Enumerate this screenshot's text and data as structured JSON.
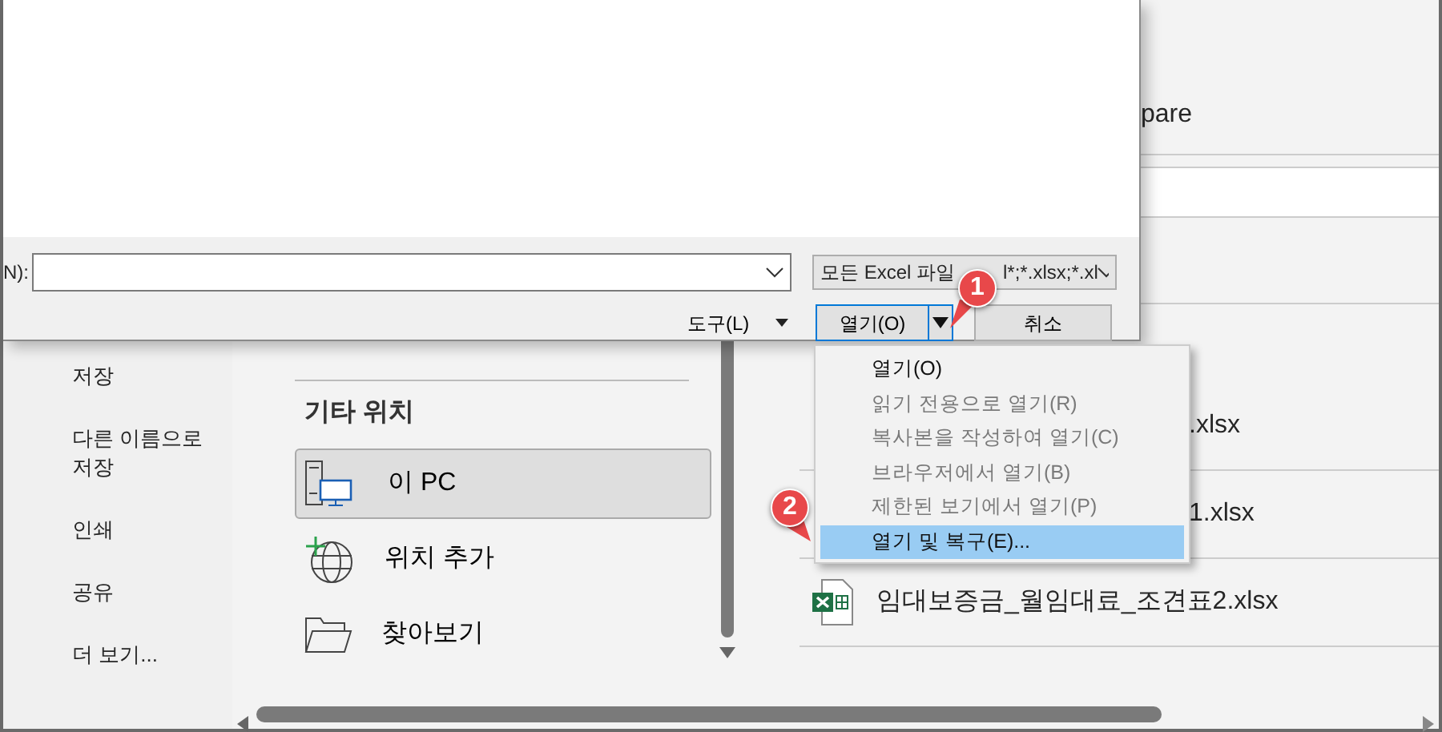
{
  "backstage": {
    "nav": [
      {
        "label": "저장"
      },
      {
        "label": "다른 이름으로\n저장"
      },
      {
        "label": "인쇄"
      },
      {
        "label": "공유"
      },
      {
        "label": "더 보기..."
      }
    ],
    "locations_heading": "기타 위치",
    "locations": [
      {
        "label": "이 PC",
        "kind": "pc",
        "selected": true
      },
      {
        "label": "위치 추가",
        "kind": "globe",
        "selected": false
      },
      {
        "label": "찾아보기",
        "kind": "folder",
        "selected": false
      }
    ],
    "files": [
      {
        "name": "pare",
        "kind": "top"
      },
      {
        "name": ".xlsx",
        "kind": "under-menu"
      },
      {
        "name": "1.xlsx",
        "kind": "under-menu"
      },
      {
        "name": "임대보증금_월임대료_조견표2.xlsx",
        "kind": "excel"
      }
    ]
  },
  "dialog": {
    "filename_label": "N):",
    "filetype_parts": [
      "모든 Excel 파일",
      "l*;*.xlsx;*.xl"
    ],
    "tools_button": "도구(L)",
    "open_button": "열기(O)",
    "cancel_button": "취소"
  },
  "open_menu": [
    {
      "label": "열기(O)",
      "disabled": false,
      "selected": false
    },
    {
      "label": "읽기 전용으로 열기(R)",
      "disabled": true,
      "selected": false
    },
    {
      "label": "복사본을 작성하여 열기(C)",
      "disabled": true,
      "selected": false
    },
    {
      "label": "브라우저에서 열기(B)",
      "disabled": true,
      "selected": false
    },
    {
      "label": "제한된 보기에서 열기(P)",
      "disabled": true,
      "selected": false
    },
    {
      "label": "열기 및 복구(E)...",
      "disabled": false,
      "selected": true
    }
  ],
  "callouts": [
    {
      "number": "1"
    },
    {
      "number": "2"
    }
  ]
}
